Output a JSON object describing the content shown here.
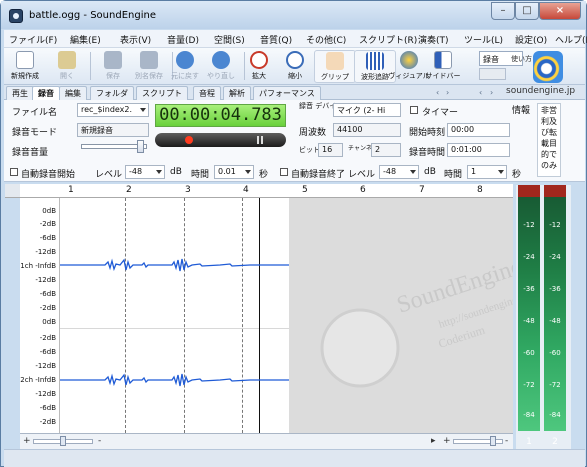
{
  "window": {
    "title": "battle.ogg - SoundEngine"
  },
  "caption_buttons": [
    "–",
    "□",
    "×"
  ],
  "menu": [
    "ファイル(F)",
    "編集(E)",
    "表示(V)",
    "音量(D)",
    "空間(S)",
    "音質(Q)",
    "その他(C)",
    "スクリプト(R)",
    "演奏(T)",
    "ツール(L)",
    "設定(O)",
    "ヘルプ(H)"
  ],
  "toolbar": {
    "items": [
      "新規作成",
      "開く",
      "保存",
      "別名保存",
      "元に戻す",
      "やり直し",
      "拡大",
      "縮小",
      "グリップ",
      "波形追跡",
      "ヴィジュアル",
      "サイドバー"
    ],
    "record_mode": "録音",
    "usage_label": "使い方"
  },
  "tabs": [
    "再生",
    "録音",
    "編集",
    "フォルダ",
    "スクリプト",
    "音程",
    "解析",
    "パフォーマンス"
  ],
  "tab_nav": [
    "‹",
    "›",
    "‹",
    "›"
  ],
  "site": "soundengine.jp",
  "panel": {
    "filename_label": "ファイル名",
    "filename_value": "rec_$index2.",
    "mode_label": "録音モード",
    "mode_value": "新規録音",
    "volume_label": "録音音量",
    "time": "00:00:04.783",
    "device_label": "録音 デバイス",
    "device_value": "マイク (2- Hi",
    "timer_label": "タイマー",
    "info_label": "情報",
    "freq_label": "周波数",
    "freq_value": "44100",
    "start_time_label": "開始時刻",
    "start_time_value": "00:00",
    "bit_label": "ビット",
    "bit_value": "16",
    "ch_label": "チャンネル",
    "ch_value": "2",
    "rec_time_label": "録音時間",
    "rec_time_value": "0:01:00",
    "auto_start_label": "自動録音開始",
    "level_label": "レベル",
    "level_value": "-48",
    "db_unit": "dB",
    "time_label": "時間",
    "time_value": "0.01",
    "sec_unit": "秒",
    "auto_end_label": "自動録音終了",
    "level_value2": "-48",
    "time_value2": "1",
    "note": "非営利及び転載目的でのみ"
  },
  "ruler": [
    "1",
    "2",
    "3",
    "4",
    "5",
    "6",
    "7",
    "8"
  ],
  "db_scale_1": [
    "0dB",
    "-2dB",
    "-6dB",
    "-12dB",
    "1ch -InfdB",
    "-12dB",
    "-6dB",
    "-2dB",
    "0dB"
  ],
  "db_scale_2": [
    "-2dB",
    "-6dB",
    "-12dB",
    "2ch -InfdB",
    "-12dB",
    "-6dB",
    "-2dB",
    "0dB"
  ],
  "watermark": [
    "SoundEngine",
    "http://soundengine.jp",
    "Coderium"
  ],
  "meter": {
    "labels": [
      "-12",
      "-24",
      "-36",
      "-48",
      "-60",
      "-72",
      "-84"
    ],
    "channels": [
      "1",
      "2"
    ]
  },
  "bottom": {
    "plus": "+",
    "minus": "-",
    "plus2": "+"
  }
}
